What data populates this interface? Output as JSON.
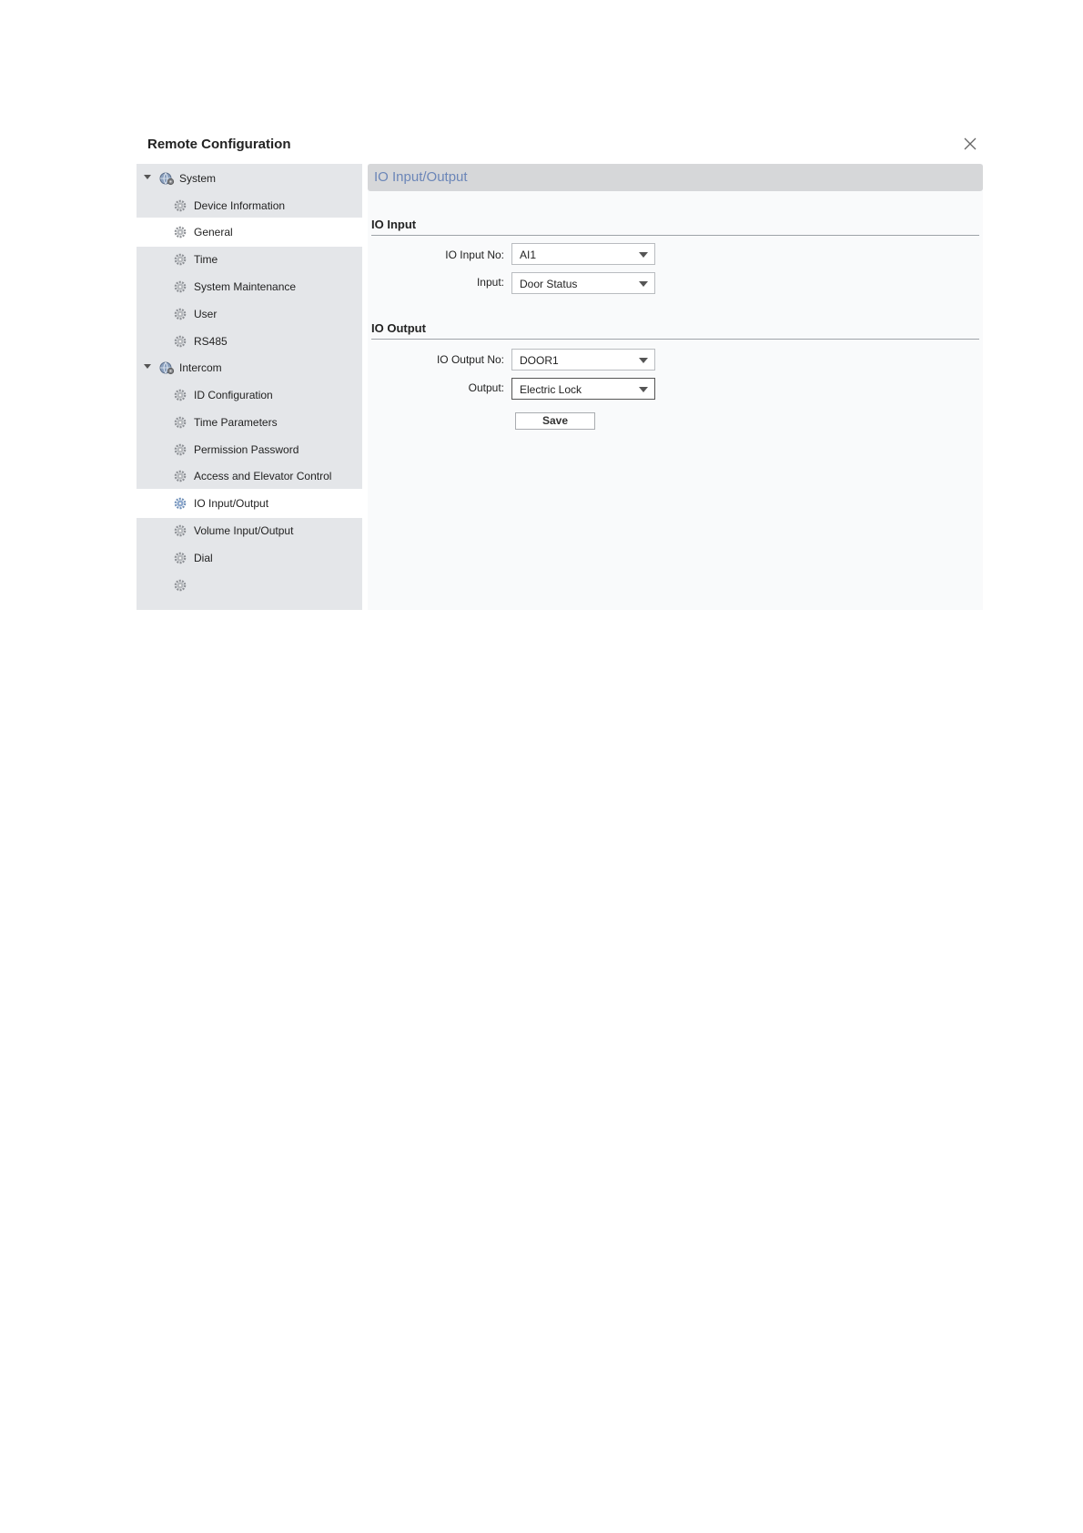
{
  "dialog": {
    "title": "Remote Configuration",
    "close_icon": "close-icon"
  },
  "sidebar": {
    "groups": [
      {
        "label": "System",
        "icon": "globe-gear-icon",
        "items": [
          {
            "label": "Device Information",
            "icon": "gear-icon"
          },
          {
            "label": "General",
            "icon": "gear-icon"
          },
          {
            "label": "Time",
            "icon": "gear-icon"
          },
          {
            "label": "System Maintenance",
            "icon": "gear-icon"
          },
          {
            "label": "User",
            "icon": "gear-icon"
          },
          {
            "label": "RS485",
            "icon": "gear-icon"
          }
        ]
      },
      {
        "label": "Intercom",
        "icon": "globe-gear-icon",
        "items": [
          {
            "label": "ID Configuration",
            "icon": "gear-icon"
          },
          {
            "label": "Time Parameters",
            "icon": "gear-icon"
          },
          {
            "label": "Permission Password",
            "icon": "gear-icon"
          },
          {
            "label": "Access and Elevator Control",
            "icon": "gear-icon"
          },
          {
            "label": "IO Input/Output",
            "icon": "gear-icon"
          },
          {
            "label": "Volume Input/Output",
            "icon": "gear-icon"
          },
          {
            "label": "Dial",
            "icon": "gear-icon"
          }
        ]
      }
    ]
  },
  "content": {
    "header": "IO Input/Output",
    "io_input": {
      "title": "IO Input",
      "input_no_label": "IO Input No:",
      "input_no_value": "AI1",
      "input_label": "Input:",
      "input_value": "Door Status"
    },
    "io_output": {
      "title": "IO Output",
      "output_no_label": "IO Output No:",
      "output_no_value": "DOOR1",
      "output_label": "Output:",
      "output_value": "Electric Lock"
    },
    "save_label": "Save"
  },
  "colors": {
    "header_text": "#6b86b8",
    "sidebar_bg": "#e4e6e9",
    "selected_bg": "#ffffff",
    "content_bg": "#f9fafb"
  }
}
